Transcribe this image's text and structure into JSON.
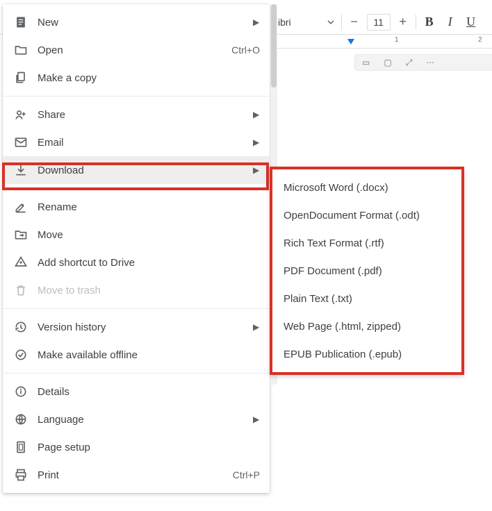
{
  "toolbar": {
    "font_name": "ibri",
    "font_size": "11",
    "ruler": {
      "n1": "1",
      "n2": "2"
    }
  },
  "file_menu": {
    "new": "New",
    "open": "Open",
    "open_shortcut": "Ctrl+O",
    "copy": "Make a copy",
    "share": "Share",
    "email": "Email",
    "download": "Download",
    "rename": "Rename",
    "move": "Move",
    "shortcut": "Add shortcut to Drive",
    "trash": "Move to trash",
    "version": "Version history",
    "offline": "Make available offline",
    "details": "Details",
    "language": "Language",
    "pagesetup": "Page setup",
    "print": "Print",
    "print_shortcut": "Ctrl+P"
  },
  "download_submenu": {
    "docx": "Microsoft Word (.docx)",
    "odt": "OpenDocument Format (.odt)",
    "rtf": "Rich Text Format (.rtf)",
    "pdf": "PDF Document (.pdf)",
    "txt": "Plain Text (.txt)",
    "html": "Web Page (.html, zipped)",
    "epub": "EPUB Publication (.epub)"
  }
}
